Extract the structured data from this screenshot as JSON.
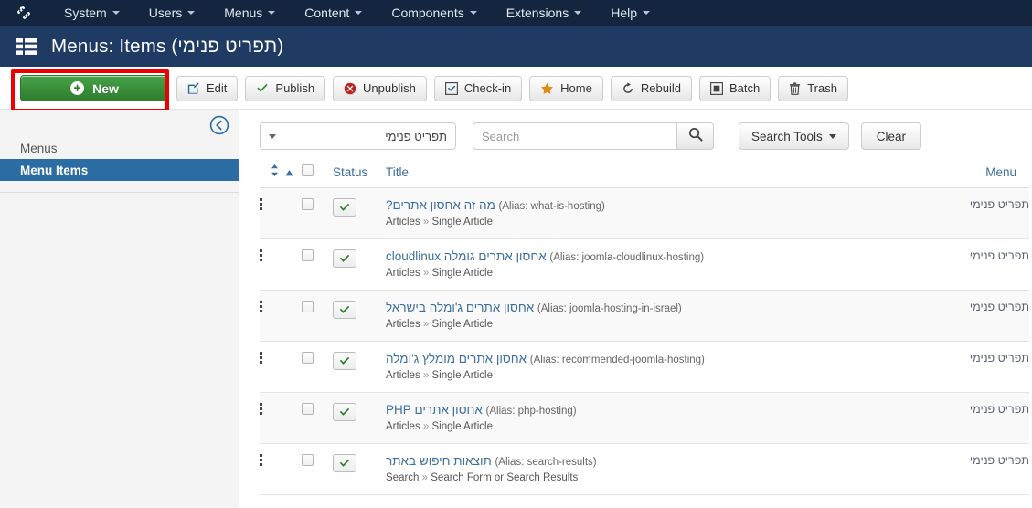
{
  "topnav": {
    "logo": "joomla-logo",
    "items": [
      {
        "label": "System",
        "has_caret": true
      },
      {
        "label": "Users",
        "has_caret": true
      },
      {
        "label": "Menus",
        "has_caret": true
      },
      {
        "label": "Content",
        "has_caret": true
      },
      {
        "label": "Components",
        "has_caret": true
      },
      {
        "label": "Extensions",
        "has_caret": true
      },
      {
        "label": "Help",
        "has_caret": true
      }
    ]
  },
  "header": {
    "icon": "list-icon",
    "title": "Menus: Items (תפריט פנימי)"
  },
  "toolbar": {
    "new_label": "New",
    "edit_label": "Edit",
    "publish_label": "Publish",
    "unpublish_label": "Unpublish",
    "checkin_label": "Check-in",
    "home_label": "Home",
    "rebuild_label": "Rebuild",
    "batch_label": "Batch",
    "trash_label": "Trash",
    "highlight_color": "#ee0000",
    "new_button_color": "#3c9e3c"
  },
  "sidebar": {
    "collapse_icon": "circle-left-arrow-icon",
    "items": [
      {
        "label": "Menus",
        "active": false
      },
      {
        "label": "Menu Items",
        "active": true
      }
    ]
  },
  "filters": {
    "menu_select_value": "תפריט פנימי",
    "search_placeholder": "Search",
    "search_value": "",
    "search_icon": "search-icon",
    "search_tools_label": "Search Tools",
    "clear_label": "Clear"
  },
  "table": {
    "columns": {
      "sort": "",
      "check": "",
      "status": "Status",
      "title": "Title",
      "menu": "Menu"
    },
    "rows": [
      {
        "title": "מה זה אחסון אתרים?",
        "alias": "(Alias: what-is-hosting)",
        "type": "Articles",
        "subtype": "Single Article",
        "menu": "תפריט פנימי",
        "status": "published"
      },
      {
        "title": "אחסון אתרים גומלה cloudlinux",
        "alias": "(Alias: joomla-cloudlinux-hosting)",
        "type": "Articles",
        "subtype": "Single Article",
        "menu": "תפריט פנימי",
        "status": "published"
      },
      {
        "title": "אחסון אתרים ג'ומלה בישראל",
        "alias": "(Alias: joomla-hosting-in-israel)",
        "type": "Articles",
        "subtype": "Single Article",
        "menu": "תפריט פנימי",
        "status": "published"
      },
      {
        "title": "אחסון אתרים מומלץ ג'ומלה",
        "alias": "(Alias: recommended-joomla-hosting)",
        "type": "Articles",
        "subtype": "Single Article",
        "menu": "תפריט פנימי",
        "status": "published"
      },
      {
        "title": "אחסון אתרים PHP",
        "alias": "(Alias: php-hosting)",
        "type": "Articles",
        "subtype": "Single Article",
        "menu": "תפריט פנימי",
        "status": "published"
      },
      {
        "title": "תוצאות חיפוש באתר",
        "alias": "(Alias: search-results)",
        "type": "Search",
        "subtype": "Search Form or Search Results",
        "menu": "תפריט פנימי",
        "status": "published"
      }
    ],
    "separator": "»"
  }
}
